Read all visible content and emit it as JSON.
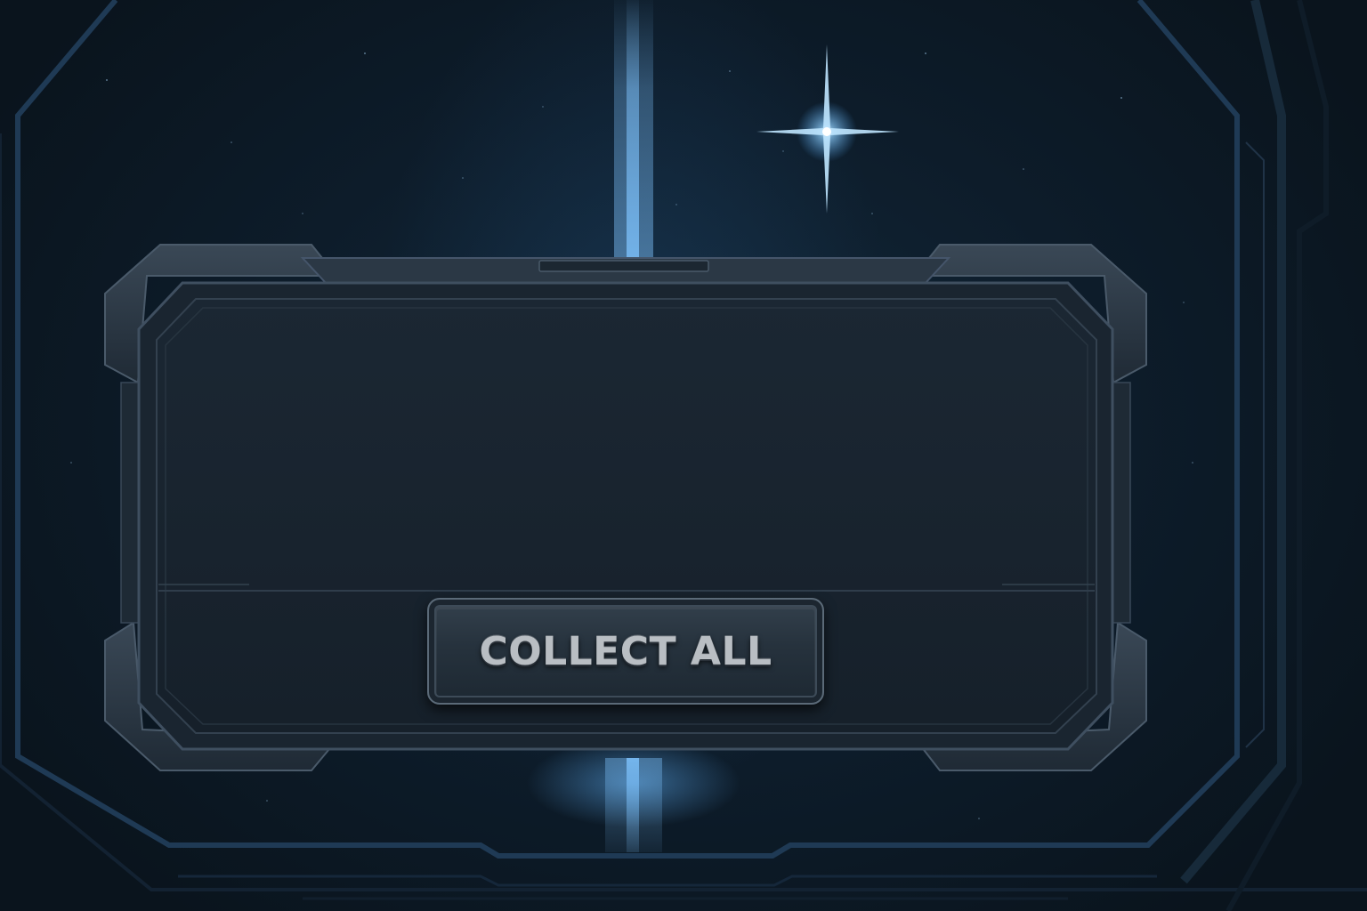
{
  "panel": {
    "collect_button_label": "COLLECT ALL"
  },
  "colors": {
    "background": "#0d1c2a",
    "frame_metal": "#26323e",
    "frame_edge": "#4a5a6a",
    "panel_fill": "#18232e",
    "light_beam": "#7fc4ff",
    "button_text": "#b9bec3"
  },
  "icons": {
    "star": "four-point-star-icon"
  }
}
